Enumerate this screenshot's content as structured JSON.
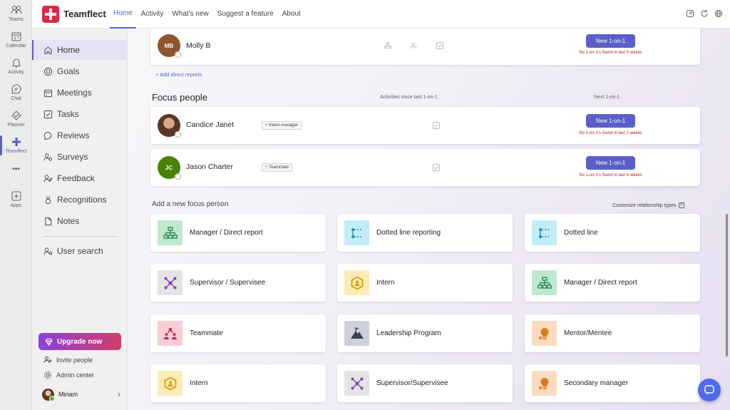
{
  "rail": {
    "items": [
      {
        "label": "Teams"
      },
      {
        "label": "Calendar"
      },
      {
        "label": "Activity"
      },
      {
        "label": "Chat"
      },
      {
        "label": "Planner"
      },
      {
        "label": "Teamflect"
      },
      {
        "label": "Apps"
      }
    ],
    "more": "•••"
  },
  "topbar": {
    "app_name": "Teamflect",
    "tabs": [
      "Home",
      "Activity",
      "What's new",
      "Suggest a feature",
      "About"
    ],
    "active_tab": "Home"
  },
  "sidebar": {
    "items": [
      {
        "label": "Home",
        "icon": "home-icon"
      },
      {
        "label": "Goals",
        "icon": "target-icon"
      },
      {
        "label": "Meetings",
        "icon": "calendar-icon"
      },
      {
        "label": "Tasks",
        "icon": "checkbox-icon"
      },
      {
        "label": "Reviews",
        "icon": "review-icon"
      },
      {
        "label": "Surveys",
        "icon": "surveys-icon"
      },
      {
        "label": "Feedback",
        "icon": "feedback-icon"
      },
      {
        "label": "Recognitions",
        "icon": "badge-icon"
      },
      {
        "label": "Notes",
        "icon": "note-icon"
      },
      {
        "label": "User search",
        "icon": "user-search-icon"
      }
    ],
    "upgrade_label": "Upgrade now",
    "invite_label": "Invite people",
    "admin_label": "Admin center",
    "user_name": "Miriam"
  },
  "direct_reports": [
    {
      "initials": "MB",
      "name": "Molly B",
      "avatar_color": "#8e562e",
      "button": "New 1-on-1",
      "status": "No 1-on-1's found in last 0 weeks"
    }
  ],
  "add_direct_reports": "+ Add direct reports",
  "focus": {
    "title": "Focus people",
    "col_activities": "Activities since last 1-on-1",
    "col_next": "Next 1-on-1",
    "people": [
      {
        "name": "Candice Janet",
        "tag": "Intern manager",
        "button": "New 1-on-1",
        "status": "No 1-on-1's found in last 2 weeks"
      },
      {
        "initials": "JC",
        "name": "Jason Charter",
        "avatar_color": "#498205",
        "tag": "Teammate",
        "button": "New 1-on-1",
        "status": "No 1-on-1's found in last 4 weeks"
      }
    ]
  },
  "add_focus": {
    "title": "Add a new focus person",
    "customize": "Customize relationship types",
    "types": [
      {
        "label": "Manager / Direct report",
        "icon": "org-chart-icon",
        "bg": "#bfe8cf",
        "fg": "#2f8a55"
      },
      {
        "label": "Dotted line reporting",
        "icon": "dotted-line-icon",
        "bg": "#c2ecf7",
        "fg": "#1e8fb3"
      },
      {
        "label": "Dotted line",
        "icon": "dotted-line-icon",
        "bg": "#c2ecf7",
        "fg": "#1e8fb3"
      },
      {
        "label": "Supervisor / Supervisee",
        "icon": "network-icon",
        "bg": "#e3e3e6",
        "fg": "#8b3fb0"
      },
      {
        "label": "Intern",
        "icon": "hexagon-icon",
        "bg": "#fdebb6",
        "fg": "#d99a00"
      },
      {
        "label": "Manager / Direct report",
        "icon": "org-chart-icon",
        "bg": "#bfe8cf",
        "fg": "#2f8a55"
      },
      {
        "label": "Teammate",
        "icon": "team-icon",
        "bg": "#f8cdd5",
        "fg": "#c23152"
      },
      {
        "label": "Leadership Program",
        "icon": "mountain-icon",
        "bg": "#cdd0dc",
        "fg": "#3b4252"
      },
      {
        "label": "Mentor/Mentee",
        "icon": "lightbulb-icon",
        "bg": "#fcdcc0",
        "fg": "#e07a1f"
      },
      {
        "label": "Intern",
        "icon": "hexagon-icon",
        "bg": "#fdebb6",
        "fg": "#d99a00"
      },
      {
        "label": "Supervisor/Supervisee",
        "icon": "network-icon",
        "bg": "#e3e3e6",
        "fg": "#8b3fb0"
      },
      {
        "label": "Secondary manager",
        "icon": "lightbulb-icon",
        "bg": "#fcdcc0",
        "fg": "#e07a1f"
      }
    ]
  }
}
